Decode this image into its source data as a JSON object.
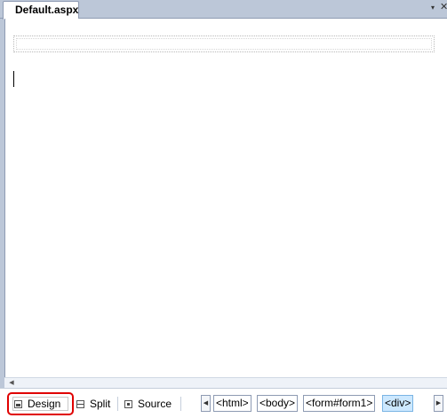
{
  "document_tab": {
    "title": "Default.aspx"
  },
  "icons": {
    "tab_scroll": "▾",
    "tab_close": "✕",
    "scroll_left": "◀",
    "crumb_prev": "◀",
    "crumb_next": "▶"
  },
  "view_bar": {
    "design_label": "Design",
    "split_label": "Split",
    "source_label": "Source",
    "selected": "Design"
  },
  "breadcrumb": [
    {
      "label": "<html>"
    },
    {
      "label": "<body>"
    },
    {
      "label": "<form#form1>"
    },
    {
      "label": "<div>",
      "active": true
    }
  ],
  "colors": {
    "highlight_border": "#e00000",
    "active_crumb": "#cce8ff",
    "chrome": "#bcc7d8"
  }
}
